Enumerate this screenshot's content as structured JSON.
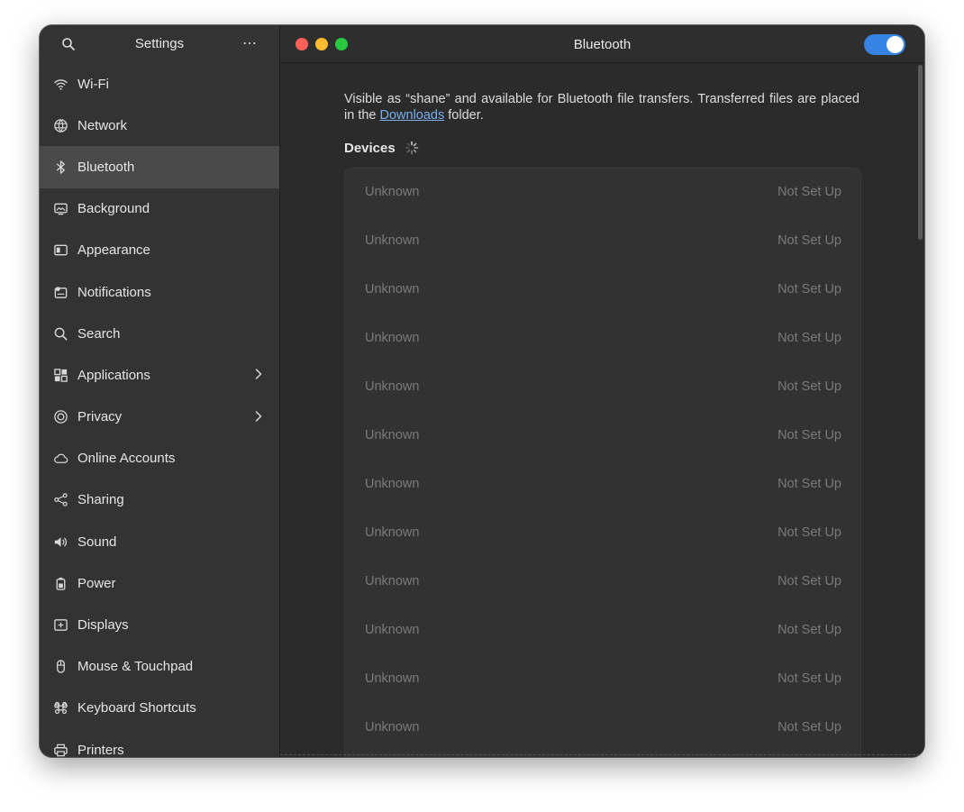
{
  "sidebar": {
    "title": "Settings",
    "more_label": "⋯",
    "items": [
      {
        "label": "Wi-Fi",
        "icon": "wifi-icon"
      },
      {
        "label": "Network",
        "icon": "network-icon"
      },
      {
        "label": "Bluetooth",
        "icon": "bluetooth-icon",
        "active": true
      },
      {
        "label": "Background",
        "icon": "background-icon"
      },
      {
        "label": "Appearance",
        "icon": "appearance-icon"
      },
      {
        "label": "Notifications",
        "icon": "notifications-icon"
      },
      {
        "label": "Search",
        "icon": "search-icon"
      },
      {
        "label": "Applications",
        "icon": "applications-icon",
        "chevron": true
      },
      {
        "label": "Privacy",
        "icon": "privacy-icon",
        "chevron": true
      },
      {
        "label": "Online Accounts",
        "icon": "cloud-icon"
      },
      {
        "label": "Sharing",
        "icon": "sharing-icon"
      },
      {
        "label": "Sound",
        "icon": "speaker-icon"
      },
      {
        "label": "Power",
        "icon": "power-icon"
      },
      {
        "label": "Displays",
        "icon": "displays-icon"
      },
      {
        "label": "Mouse & Touchpad",
        "icon": "mouse-icon"
      },
      {
        "label": "Keyboard Shortcuts",
        "icon": "command-icon"
      },
      {
        "label": "Printers",
        "icon": "printer-icon"
      }
    ]
  },
  "header": {
    "title": "Bluetooth",
    "bluetooth_enabled": true,
    "accent_color": "#3584e4"
  },
  "main": {
    "description_prefix": "Visible as “shane” and available for Bluetooth file transfers. Transferred files are placed in the ",
    "description_link": "Downloads",
    "description_suffix": " folder.",
    "devices_title": "Devices",
    "devices": [
      {
        "name": "Unknown",
        "status": "Not Set Up"
      },
      {
        "name": "Unknown",
        "status": "Not Set Up"
      },
      {
        "name": "Unknown",
        "status": "Not Set Up"
      },
      {
        "name": "Unknown",
        "status": "Not Set Up"
      },
      {
        "name": "Unknown",
        "status": "Not Set Up"
      },
      {
        "name": "Unknown",
        "status": "Not Set Up"
      },
      {
        "name": "Unknown",
        "status": "Not Set Up"
      },
      {
        "name": "Unknown",
        "status": "Not Set Up"
      },
      {
        "name": "Unknown",
        "status": "Not Set Up"
      },
      {
        "name": "Unknown",
        "status": "Not Set Up"
      },
      {
        "name": "Unknown",
        "status": "Not Set Up"
      },
      {
        "name": "Unknown",
        "status": "Not Set Up"
      }
    ]
  }
}
